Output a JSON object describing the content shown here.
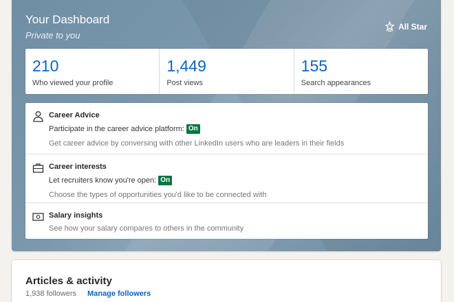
{
  "dashboard": {
    "title": "Your Dashboard",
    "subtitle": "Private to you",
    "badge_label": "All Star",
    "badge_icon": "star-icon",
    "stats": [
      {
        "value": "210",
        "label": "Who viewed your profile"
      },
      {
        "value": "1,449",
        "label": "Post views"
      },
      {
        "value": "155",
        "label": "Search appearances"
      }
    ],
    "features": [
      {
        "icon": "person-icon",
        "title": "Career Advice",
        "line": "Participate in the career advice platform:",
        "status": "On",
        "description": "Get career advice by conversing with other LinkedIn users who are leaders in their fields"
      },
      {
        "icon": "briefcase-icon",
        "title": "Career interests",
        "line": "Let recruiters know you're open:",
        "status": "On",
        "description": "Choose the types of opportunities you'd like to be connected with"
      },
      {
        "icon": "money-icon",
        "title": "Salary insights",
        "description": "See how your salary compares to others in the community"
      }
    ]
  },
  "articles": {
    "title": "Articles & activity",
    "followers": "1,938 followers",
    "manage_link": "Manage followers"
  },
  "colors": {
    "accent": "#0a66c2",
    "status_on": "#057642",
    "dashboard_bg": "#7b98ad"
  }
}
